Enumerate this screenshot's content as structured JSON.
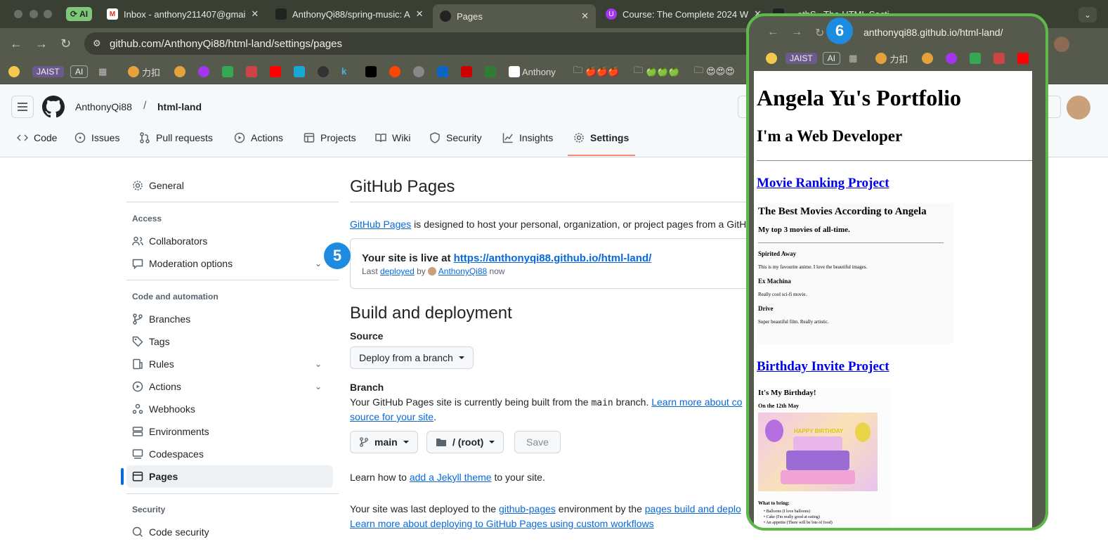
{
  "browser": {
    "tabs": [
      {
        "label": "AI",
        "kind": "group"
      },
      {
        "label": "Inbox - anthony211407@gmai",
        "icon": "gmail-icon"
      },
      {
        "label": "AnthonyQi88/spring-music: A",
        "icon": "github-icon"
      },
      {
        "label": "Pages",
        "icon": "github-icon",
        "active": true
      },
      {
        "label": "Course: The Complete 2024 W",
        "icon": "udemy-icon"
      },
      {
        "label": "...ethS.. The HTML Secti...",
        "icon": "github-icon"
      }
    ],
    "url": "github.com/AnthonyQi88/html-land/settings/pages",
    "bookmarks": [
      "JAIST",
      "AI",
      "力扣",
      "Anthony",
      "🍎🍎🍎",
      "🍏🍏🍏",
      "😍😍😍"
    ]
  },
  "github": {
    "owner": "AnthonyQi88",
    "sep": "/",
    "repo": "html-land",
    "nav": [
      "Code",
      "Issues",
      "Pull requests",
      "Actions",
      "Projects",
      "Wiki",
      "Security",
      "Insights",
      "Settings"
    ]
  },
  "sidebar": {
    "general": "General",
    "access_head": "Access",
    "collaborators": "Collaborators",
    "moderation": "Moderation options",
    "code_head": "Code and automation",
    "branches": "Branches",
    "tags": "Tags",
    "rules": "Rules",
    "actions": "Actions",
    "webhooks": "Webhooks",
    "environments": "Environments",
    "codespaces": "Codespaces",
    "pages": "Pages",
    "security_head": "Security",
    "code_security": "Code security"
  },
  "main": {
    "title": "GitHub Pages",
    "intro_link": "GitHub Pages",
    "intro_text": "is designed to host your personal, organization, or project pages from a GitHub",
    "live_prefix": "Your site is live at",
    "live_url": "https://anthonyqi88.github.io/html-land/",
    "last": "Last",
    "deployed": "deployed",
    "by": "by",
    "deployer": "AnthonyQi88",
    "now": "now",
    "build_title": "Build and deployment",
    "source_label": "Source",
    "source_value": "Deploy from a branch",
    "branch_label": "Branch",
    "branch_text_a": "Your GitHub Pages site is currently being built from the",
    "branch_code": "main",
    "branch_text_b": "branch.",
    "branch_link_a": "Learn more about co",
    "branch_link_b": "source for your site",
    "branch_period": ".",
    "branch_select": "main",
    "folder_select": "/ (root)",
    "save": "Save",
    "jekyll_prefix": "Learn how to",
    "jekyll_link": "add a Jekyll theme",
    "jekyll_suffix": "to your site.",
    "deploy_text_a": "Your site was last deployed to the",
    "deploy_env": "github-pages",
    "deploy_text_b": "environment by the",
    "deploy_link": "pages build and deplo",
    "deploy_more": "Learn more about deploying to GitHub Pages using custom workflows"
  },
  "badges": {
    "five": "5",
    "six": "6"
  },
  "overlay": {
    "url": "anthonyqi88.github.io/html-land/",
    "bookmarks": [
      "JAIST",
      "AI",
      "力扣"
    ],
    "h1": "Angela Yu's Portfolio",
    "h2": "I'm a Web Developer",
    "project1": "Movie Ranking Project",
    "movies_title": "The Best Movies According to Angela",
    "movies_sub": "My top 3 movies of all-time.",
    "movies": [
      {
        "name": "Spirited Away",
        "desc": "This is my favourite anime. I love the beautiful images."
      },
      {
        "name": "Ex Machina",
        "desc": "Really cool sci-fi movie."
      },
      {
        "name": "Drive",
        "desc": "Super beautiful film. Really artistic."
      }
    ],
    "project2": "Birthday Invite Project",
    "bday_title": "It's My Birthday!",
    "bday_date": "On the 12th May",
    "cake_text": "HAPPY BIRTHDAY",
    "bring_title": "What to bring:",
    "bring": [
      "Balloons (I love balloons)",
      "Cake (I'm really good at eating)",
      "An appetite (There will be lots of food)"
    ]
  },
  "colors": {
    "accent": "#0969da",
    "badge": "#1d8ce0",
    "overlay_border": "#5db94a",
    "settings_underline": "#fd8c73"
  }
}
